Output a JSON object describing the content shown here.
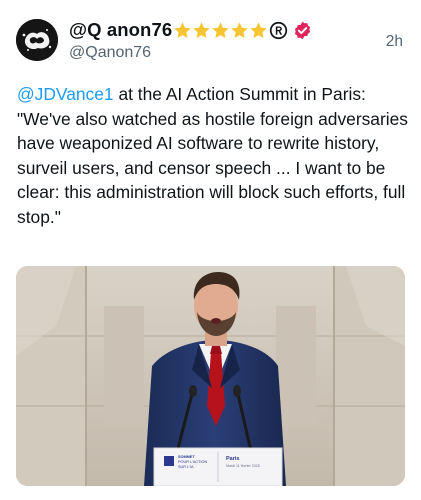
{
  "post": {
    "display_name": "@Q anon76",
    "handle": "@Qanon76",
    "timestamp": "2h",
    "star_count": 5,
    "badges": [
      "star-icon",
      "registered-icon",
      "verified-icon"
    ],
    "text": {
      "mention": "@JDVance1",
      "body": " at the AI Action Summit in Paris: \"We've also watched as hostile foreign adversaries have weaponized AI software to rewrite history, surveil users, and censor speech ... I want to be clear: this administration will block such efforts, full stop.\""
    },
    "media": {
      "type": "photo",
      "podium_sign": {
        "left_line1": "SOMMET",
        "left_line2": "POUR L'ACTION",
        "left_line3": "SUR L'IA",
        "right_title": "Paris",
        "right_sub": "Mardi 11 février 2025"
      }
    }
  },
  "colors": {
    "link": "#1d9bf0",
    "secondary_text": "#536471",
    "star": "#f7c531",
    "verified": "#e0245e"
  }
}
